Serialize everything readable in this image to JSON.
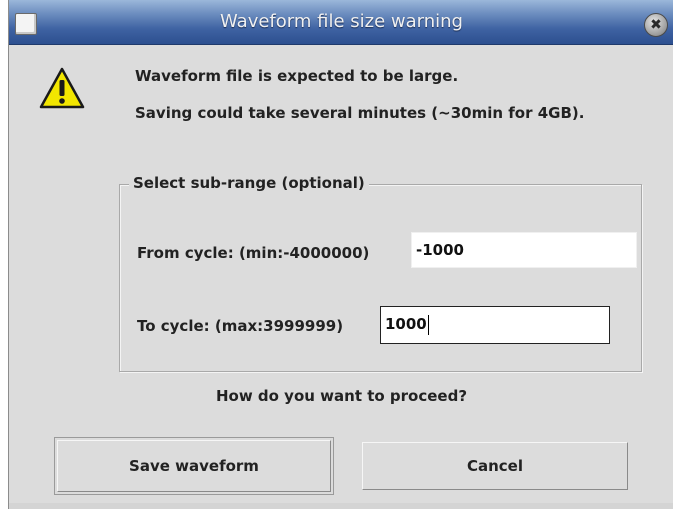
{
  "window": {
    "title": "Waveform file size warning",
    "close_glyph": "✖"
  },
  "message": {
    "icon": "warning-icon",
    "line1": "Waveform file is expected to be large.",
    "line2": "Saving could take several minutes (~30min for 4GB)."
  },
  "sub_range": {
    "legend": "Select sub-range (optional)",
    "from_label": "From cycle: (min:-4000000)",
    "from_value": "-1000",
    "to_label": "To cycle: (max:3999999)",
    "to_value": "1000"
  },
  "prompt": "How do you want to proceed?",
  "buttons": {
    "save_label": "Save waveform",
    "cancel_label": "Cancel"
  },
  "colors": {
    "titlebar": "#3f63a3",
    "dialog_bg": "#dcdcdc",
    "warning_fill": "#f2e600"
  }
}
